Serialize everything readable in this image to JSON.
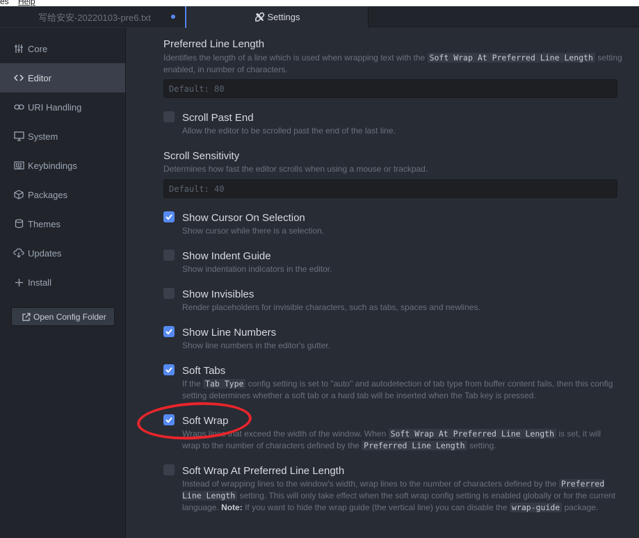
{
  "menubar": {
    "item1": "es",
    "item2": "Help"
  },
  "tabs": {
    "file_tab": "写给安安-20220103-pre6.txt",
    "settings_tab": "Settings"
  },
  "sidebar": {
    "items": [
      {
        "label": "Core",
        "icon": "sliders-icon"
      },
      {
        "label": "Editor",
        "icon": "code-icon"
      },
      {
        "label": "URI Handling",
        "icon": "link-icon"
      },
      {
        "label": "System",
        "icon": "monitor-icon"
      },
      {
        "label": "Keybindings",
        "icon": "keyboard-icon"
      },
      {
        "label": "Packages",
        "icon": "package-icon"
      },
      {
        "label": "Themes",
        "icon": "paintcan-icon"
      },
      {
        "label": "Updates",
        "icon": "cloud-download-icon"
      },
      {
        "label": "Install",
        "icon": "plus-icon"
      }
    ],
    "active": "Editor",
    "open_config_label": "Open Config Folder"
  },
  "settings": {
    "preferred_line_length": {
      "title": "Preferred Line Length",
      "desc_a": "Identifies the length of a line which is used when wrapping text with the",
      "desc_code": "Soft Wrap At Preferred Line Length",
      "desc_b": "setting enabled, in number of characters.",
      "placeholder": "Default: 80"
    },
    "scroll_past_end": {
      "title": "Scroll Past End",
      "desc": "Allow the editor to be scrolled past the end of the last line.",
      "checked": false
    },
    "scroll_sensitivity": {
      "title": "Scroll Sensitivity",
      "desc": "Determines how fast the editor scrolls when using a mouse or trackpad.",
      "placeholder": "Default: 40"
    },
    "show_cursor_on_selection": {
      "title": "Show Cursor On Selection",
      "desc": "Show cursor while there is a selection.",
      "checked": true
    },
    "show_indent_guide": {
      "title": "Show Indent Guide",
      "desc": "Show indentation indicators in the editor.",
      "checked": false
    },
    "show_invisibles": {
      "title": "Show Invisibles",
      "desc": "Render placeholders for invisible characters, such as tabs, spaces and newlines.",
      "checked": false
    },
    "show_line_numbers": {
      "title": "Show Line Numbers",
      "desc": "Show line numbers in the editor's gutter.",
      "checked": true
    },
    "soft_tabs": {
      "title": "Soft Tabs",
      "desc_a": "If the",
      "desc_code": "Tab Type",
      "desc_b": "config setting is set to \"auto\" and autodetection of tab type from buffer content fails, then this config setting determines whether a soft tab or a hard tab will be inserted when the Tab key is pressed.",
      "checked": true
    },
    "soft_wrap": {
      "title": "Soft Wrap",
      "desc_a": "Wraps lines that exceed the width of the window. When",
      "desc_code1": "Soft Wrap At Preferred Line Length",
      "desc_b": "is set, it will wrap to the number of characters defined by the",
      "desc_code2": "Preferred Line Length",
      "desc_c": "setting.",
      "checked": true
    },
    "soft_wrap_at_preferred": {
      "title": "Soft Wrap At Preferred Line Length",
      "desc_a": "Instead of wrapping lines to the window's width, wrap lines to the number of characters defined by the",
      "desc_code1": "Preferred Line Length",
      "desc_b": "setting. This will only take effect when the soft wrap config setting is enabled globally or for the current language.",
      "desc_note": "Note:",
      "desc_c": "If you want to hide the wrap guide (the vertical line) you can disable the",
      "desc_code2": "wrap-guide",
      "desc_d": "package.",
      "checked": false
    }
  },
  "colors": {
    "accent": "#568af2",
    "annotation": "#e8252b",
    "background": "#282c34",
    "sidebar": "#21252b"
  }
}
